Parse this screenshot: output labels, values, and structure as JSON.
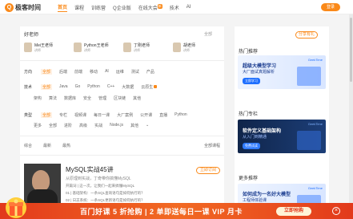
{
  "brand": {
    "logo_mark": "Q",
    "name": "极客时间"
  },
  "nav": {
    "items": [
      "首页",
      "课程",
      "训练营",
      "Q企业版",
      "在线大会",
      "技术",
      "AI"
    ],
    "active_index": 0,
    "badge": "新"
  },
  "header": {
    "login_label": "登录"
  },
  "teachers": {
    "title": "好老师",
    "more": "全部",
    "list": [
      {
        "name": "Mei王老师",
        "sub": "讲师"
      },
      {
        "name": "Python王老师",
        "sub": "讲师"
      },
      {
        "name": "丁刚老师",
        "sub": "讲师"
      },
      {
        "name": "胡老师",
        "sub": "讲师"
      }
    ]
  },
  "filters": {
    "row1": {
      "label": "方向",
      "items": [
        "全部",
        "后端",
        "前端",
        "移动",
        "AI",
        "运维",
        "测试",
        "产品"
      ]
    },
    "row2": {
      "label": "技术",
      "items": [
        "全部",
        "Java",
        "Go",
        "Python",
        "C++",
        "大数据",
        "云原生"
      ]
    },
    "row3": {
      "items": [
        "架构",
        "算法",
        "数据库",
        "安全",
        "管理",
        "区块链",
        "其他"
      ]
    },
    "row4": {
      "label": "类型",
      "items": [
        "全部",
        "专栏",
        "视频课",
        "每日一课",
        "大厂案例",
        "公开课",
        "直播",
        "Python",
        "Go",
        "AI"
      ]
    },
    "row5": {
      "items": [
        "更多",
        "全部",
        "进阶",
        "高级",
        "实战",
        "Node.js",
        "其他",
        "C++",
        "全部"
      ]
    }
  },
  "sort": {
    "items": [
      "综合",
      "最新",
      "最热"
    ],
    "right": "全部课程"
  },
  "course": {
    "title": "MySQL实战45讲",
    "subtitle": "从原理到实战，丁奇带你搞懂MySQL",
    "lines": [
      "开篇词 | 这一次，让我们一起来搞懂MySQL",
      "01 | 基础架构：一条SQL查询语句是如何执行的？",
      "02 | 日志系统：一条SQL更新语句是如何执行的？"
    ],
    "button": "立即订阅"
  },
  "side": {
    "share_label": "分享有礼",
    "sec1": "热门推荐",
    "ad1": {
      "title": "超级大模型学习",
      "sub": "大厂面试真题解析",
      "logo": "GeekTime",
      "btn": "立即学习"
    },
    "sec2": "热门专栏",
    "ad2": {
      "title": "软件定义基础架构",
      "sub": "从入门到精通",
      "logo": "GeekTime",
      "btn": "免费试读"
    },
    "sec3": "更多推荐",
    "ad3": {
      "title": "如何成为一名好大模型",
      "sub": "工程师体验课",
      "logo": "GeekTime",
      "btn": "立即领取"
    }
  },
  "banner": {
    "text": "百门好课 5 折抢购 | 2 单即送每日一课 VIP 月卡",
    "button": "立即抢购",
    "close": "×"
  },
  "colors": {
    "accent": "#fa8919",
    "banner": "#e2391b"
  }
}
